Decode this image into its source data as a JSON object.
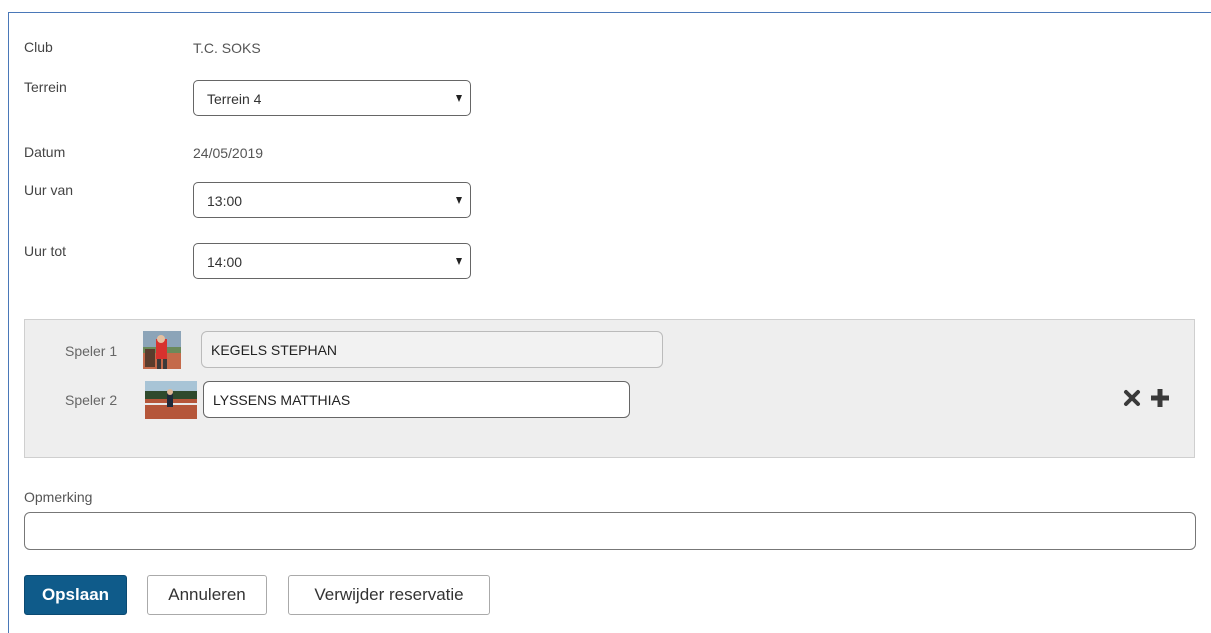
{
  "form": {
    "club_label": "Club",
    "club_value": "T.C. SOKS",
    "terrein_label": "Terrein",
    "terrein_value": "Terrein 4",
    "datum_label": "Datum",
    "datum_value": "24/05/2019",
    "uur_van_label": "Uur van",
    "uur_van_value": "13:00",
    "uur_tot_label": "Uur tot",
    "uur_tot_value": "14:00"
  },
  "players": [
    {
      "label": "Speler 1",
      "name": "KEGELS STEPHAN"
    },
    {
      "label": "Speler 2",
      "name": "LYSSENS MATTHIAS"
    }
  ],
  "player_actions": {
    "remove_icon": "close-icon",
    "add_icon": "plus-icon"
  },
  "remark": {
    "label": "Opmerking",
    "value": ""
  },
  "buttons": {
    "save": "Opslaan",
    "cancel": "Annuleren",
    "delete": "Verwijder reservatie"
  },
  "colors": {
    "primary": "#0f5b8a",
    "panel_bg": "#eeeeee",
    "frame_border": "#4a78b8"
  }
}
